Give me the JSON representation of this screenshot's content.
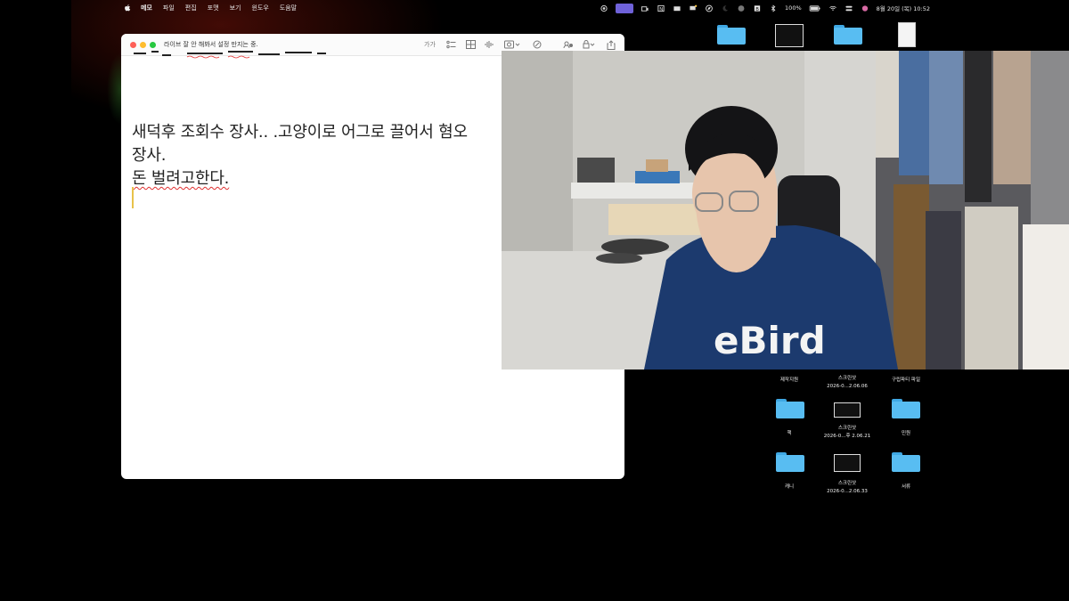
{
  "menubar": {
    "apple_icon": "apple-logo-icon",
    "items": [
      "메모",
      "파일",
      "편집",
      "포맷",
      "보기",
      "윈도우",
      "도움말"
    ],
    "battery": "100%",
    "datetime": "8월 20일 (목) 10:52"
  },
  "notes_window": {
    "title": "라이브 잘 안 해봐서 설정 만지는 중.",
    "toolbar": {
      "format_label": "가가"
    },
    "body_lines": [
      "새덕후 조회수 장사.. .고양이로 어그로 끌어서 혐오",
      "장사.",
      "돈 벌려고한다."
    ]
  },
  "desktop": {
    "items": [
      {
        "label": "제작지원",
        "type": "folder"
      },
      {
        "label": "스크린샷\n2026-0...2.06.06",
        "type": "screenshot"
      },
      {
        "label": "구립파티 파일",
        "type": "folder"
      },
      {
        "label": "책",
        "type": "folder"
      },
      {
        "label": "스크린샷\n2026-0...후 2.06.21",
        "type": "screenshot"
      },
      {
        "label": "민원",
        "type": "folder"
      },
      {
        "label": "캐니",
        "type": "folder"
      },
      {
        "label": "스크린샷\n2026-0...2.06.33",
        "type": "screenshot"
      },
      {
        "label": "서류",
        "type": "folder"
      }
    ]
  },
  "webcam": {
    "shirt_text": "eBird"
  },
  "colors": {
    "folder": "#58bdf2",
    "accent": "#6f62d9",
    "shirt": "#1c3a6e"
  }
}
